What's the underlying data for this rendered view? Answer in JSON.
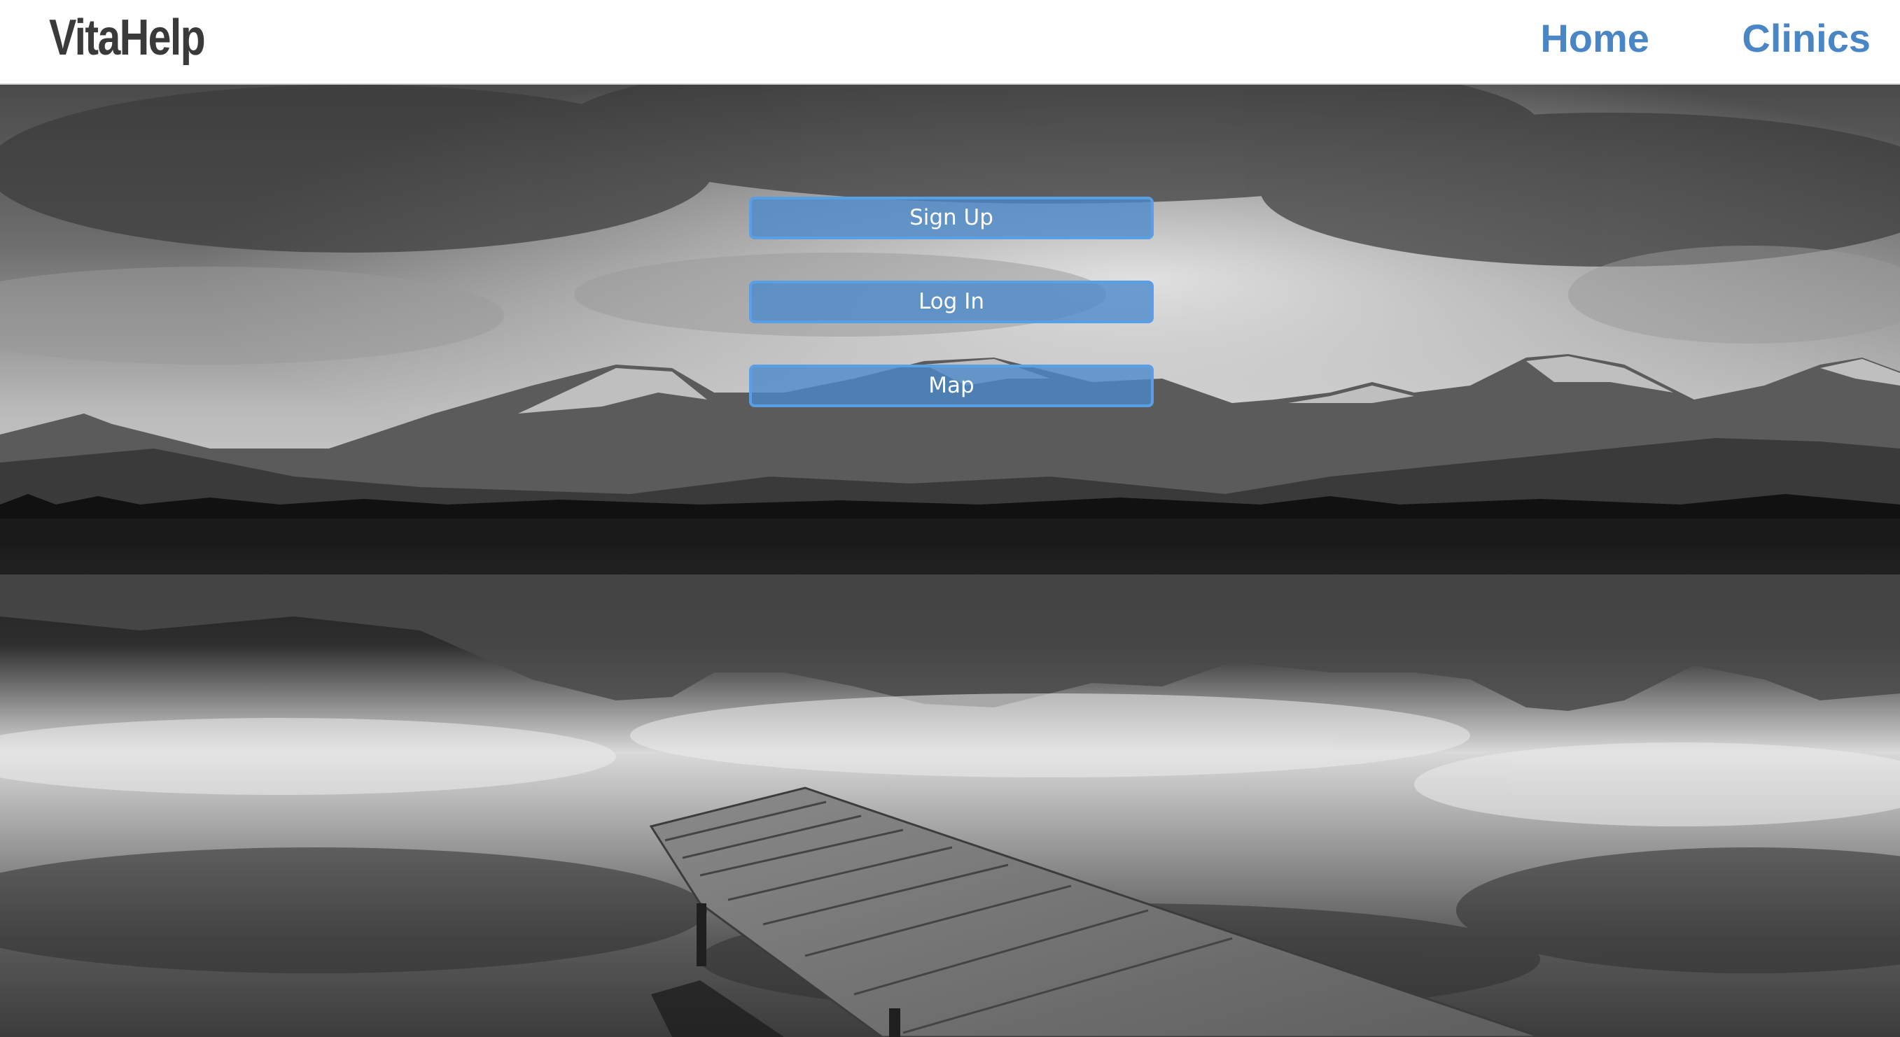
{
  "navbar": {
    "brand": "VitaHelp",
    "links": [
      {
        "label": "Home"
      },
      {
        "label": "Clinics"
      }
    ]
  },
  "actions": {
    "sign_up": "Sign Up",
    "log_in": "Log In",
    "map": "Map"
  },
  "colors": {
    "nav_link": "#4a86c5",
    "brand_text": "#3a3a3a",
    "button_fill": "#4a89cc",
    "button_border": "#5a9ee6"
  },
  "background": {
    "icon": "lake-mountains-photo"
  }
}
